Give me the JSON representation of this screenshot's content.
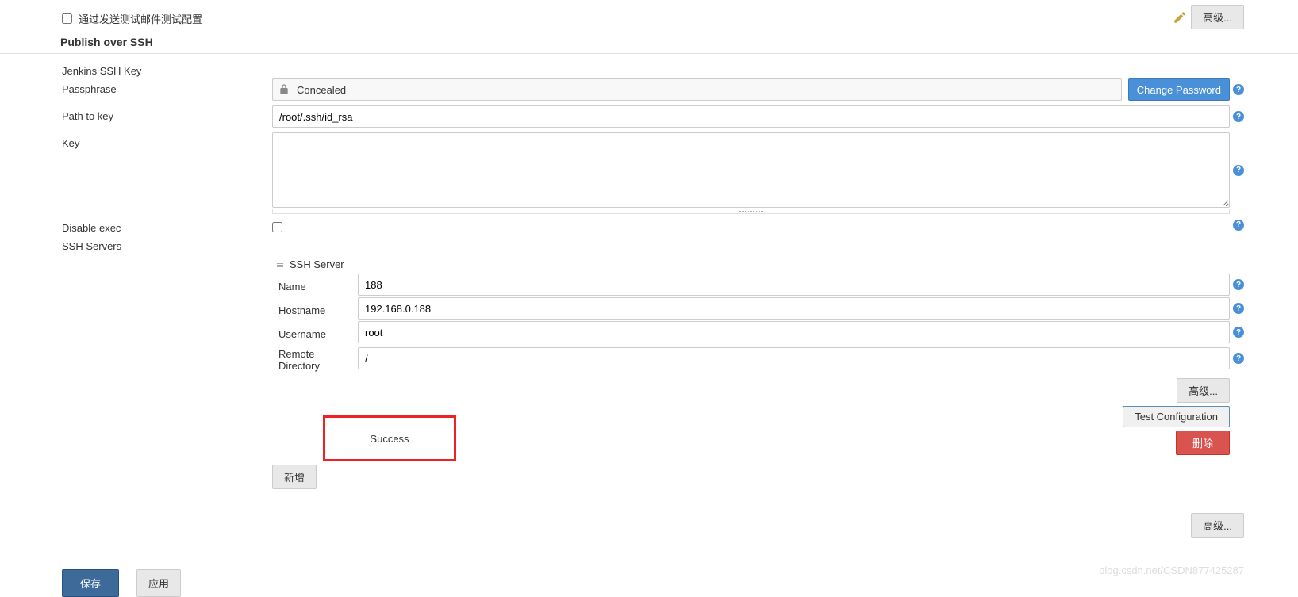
{
  "top": {
    "advanced": "高级..."
  },
  "testEmail": {
    "label": "通过发送测试邮件测试配置"
  },
  "sectionTitle": "Publish over SSH",
  "jenkinsKeyLabel": "Jenkins SSH Key",
  "passphrase": {
    "label": "Passphrase",
    "concealed": "Concealed",
    "changePassword": "Change Password"
  },
  "pathToKey": {
    "label": "Path to key",
    "value": "/root/.ssh/id_rsa"
  },
  "key": {
    "label": "Key",
    "value": ""
  },
  "disableExec": {
    "label": "Disable exec"
  },
  "sshServers": {
    "label": "SSH Servers",
    "header": "SSH Server",
    "name": {
      "label": "Name",
      "value": "188"
    },
    "hostname": {
      "label": "Hostname",
      "value": "192.168.0.188"
    },
    "username": {
      "label": "Username",
      "value": "root"
    },
    "remoteDirectory": {
      "label": "Remote Directory",
      "value": "/"
    },
    "advanced": "高级...",
    "testConfig": "Test Configuration",
    "delete": "删除",
    "successMsg": "Success"
  },
  "addNew": "新增",
  "bottomAdvanced": "高级...",
  "save": "保存",
  "apply": "应用",
  "watermark": "blog.csdn.net/CSDN877425287"
}
